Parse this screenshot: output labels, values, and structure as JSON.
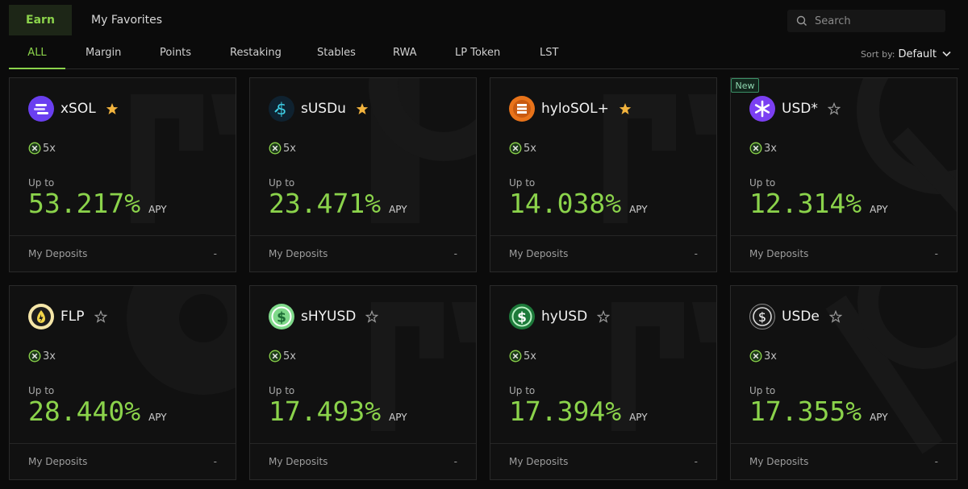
{
  "top_tabs": [
    {
      "label": "Earn",
      "active": true
    },
    {
      "label": "My Favorites",
      "active": false
    }
  ],
  "search": {
    "placeholder": "Search"
  },
  "categories": [
    "ALL",
    "Margin",
    "Points",
    "Restaking",
    "Stables",
    "RWA",
    "LP Token",
    "LST"
  ],
  "active_category": "ALL",
  "sort": {
    "label": "Sort by:",
    "value": "Default"
  },
  "badge_new": "New",
  "cards": [
    {
      "name": "xSOL",
      "favorite": true,
      "leverage": "5x",
      "upto": "Up to",
      "apy": "53.217%",
      "apy_label": "APY",
      "deposits_label": "My Deposits",
      "deposits_value": "-",
      "icon": "xsol-icon",
      "icon_color": "#6a3ff0"
    },
    {
      "name": "sUSDu",
      "favorite": true,
      "leverage": "5x",
      "upto": "Up to",
      "apy": "23.471%",
      "apy_label": "APY",
      "deposits_label": "My Deposits",
      "deposits_value": "-",
      "icon": "susdu-icon",
      "icon_color": "#0f2230"
    },
    {
      "name": "hyloSOL+",
      "favorite": true,
      "leverage": "5x",
      "upto": "Up to",
      "apy": "14.038%",
      "apy_label": "APY",
      "deposits_label": "My Deposits",
      "deposits_value": "-",
      "icon": "hylosol-icon",
      "icon_color": "#e8731a"
    },
    {
      "name": "USD*",
      "favorite": false,
      "leverage": "3x",
      "upto": "Up to",
      "apy": "12.314%",
      "apy_label": "APY",
      "deposits_label": "My Deposits",
      "deposits_value": "-",
      "icon": "usd-star-icon",
      "icon_color": "#7b3ff2",
      "is_new": true
    },
    {
      "name": "FLP",
      "favorite": false,
      "leverage": "3x",
      "upto": "Up to",
      "apy": "28.440%",
      "apy_label": "APY",
      "deposits_label": "My Deposits",
      "deposits_value": "-",
      "icon": "flp-icon",
      "icon_color": "#f5e6a8"
    },
    {
      "name": "sHYUSD",
      "favorite": false,
      "leverage": "5x",
      "upto": "Up to",
      "apy": "17.493%",
      "apy_label": "APY",
      "deposits_label": "My Deposits",
      "deposits_value": "-",
      "icon": "shyusd-icon",
      "icon_color": "#7fd98a"
    },
    {
      "name": "hyUSD",
      "favorite": false,
      "leverage": "5x",
      "upto": "Up to",
      "apy": "17.394%",
      "apy_label": "APY",
      "deposits_label": "My Deposits",
      "deposits_value": "-",
      "icon": "hyusd-icon",
      "icon_color": "#1d7a3a"
    },
    {
      "name": "USDe",
      "favorite": false,
      "leverage": "3x",
      "upto": "Up to",
      "apy": "17.355%",
      "apy_label": "APY",
      "deposits_label": "My Deposits",
      "deposits_value": "-",
      "icon": "usde-icon",
      "icon_color": "#1a1a1a"
    }
  ],
  "colors": {
    "accent": "#8bd34b",
    "star_filled": "#f2b33d",
    "background": "#0b0b0b",
    "card": "#111111"
  }
}
